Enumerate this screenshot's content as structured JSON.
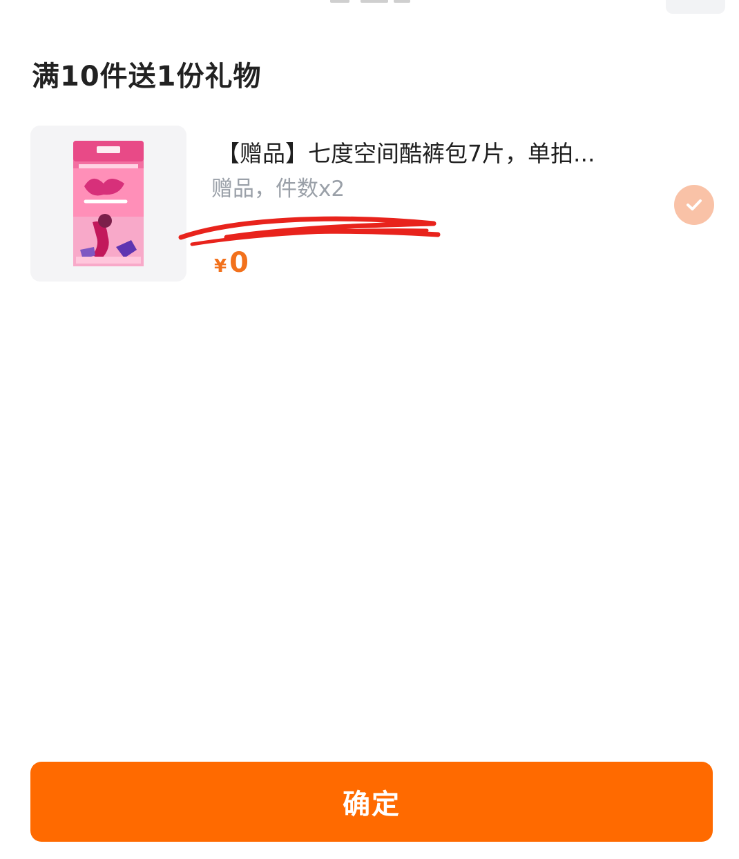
{
  "section": {
    "title": "满10件送1份礼物"
  },
  "gift": {
    "title": "【赠品】七度空间酷裤包7片，单拍...",
    "meta": "赠品，件数x2",
    "price_currency": "¥",
    "price_amount": "0",
    "selected": true,
    "thumb_icon": "product-package-image"
  },
  "footer": {
    "confirm_label": "确定"
  },
  "colors": {
    "accent": "#ff6a00",
    "price": "#f2711c",
    "check": "#f9c2a7"
  }
}
